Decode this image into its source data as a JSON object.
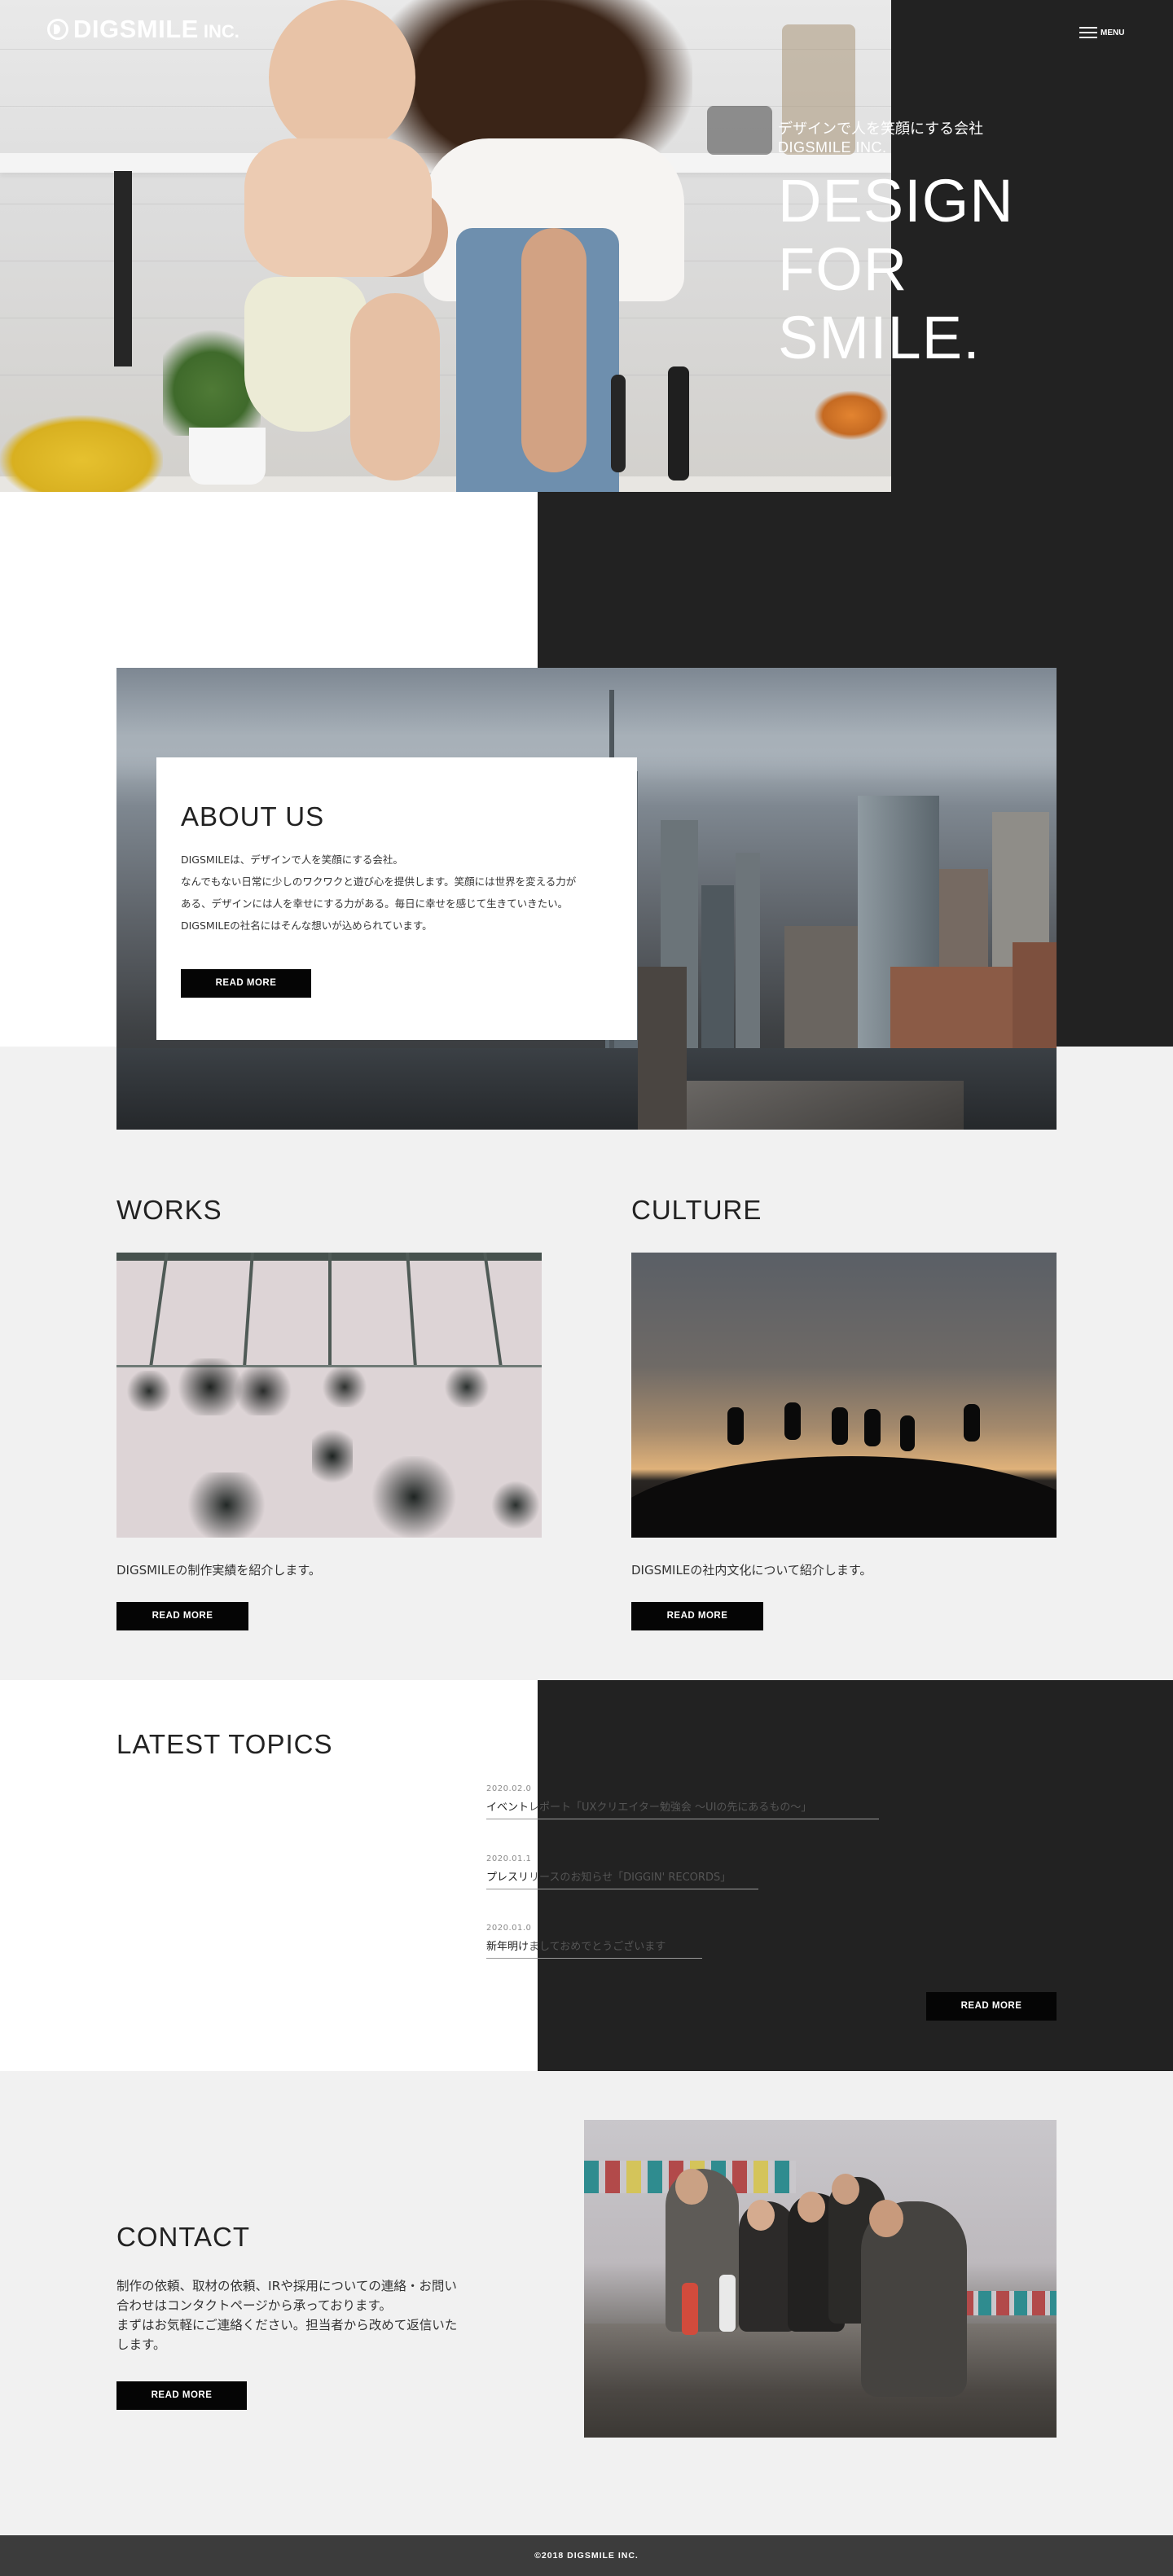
{
  "brand": {
    "name": "DIGSMILE",
    "suffix": "INC."
  },
  "nav": {
    "menu_label": "MENU"
  },
  "hero": {
    "tagline_jp": "デザインで人を笑顔にする会社",
    "company": "DIGSMILE INC.",
    "headline": [
      "DESIGN",
      "FOR",
      "SMILE."
    ]
  },
  "about": {
    "title": "ABOUT US",
    "lines": [
      "DIGSMILEは、デザインで人を笑顔にする会社。",
      "なんでもない日常に少しのワクワクと遊び心を提供します。笑顔には世界を変える力が",
      "ある、デザインには人を幸せにする力がある。毎日に幸せを感じて生きていきたい。",
      "DIGSMILEの社名にはそんな想いが込められています。"
    ],
    "button_label": "READ MORE"
  },
  "works": {
    "title": "WORKS",
    "description": "DIGSMILEの制作実績を紹介します。",
    "button_label": "READ MORE"
  },
  "culture": {
    "title": "CULTURE",
    "description": "DIGSMILEの社内文化について紹介します。",
    "button_label": "READ MORE"
  },
  "topics": {
    "title": "LATEST TOPICS",
    "items": [
      {
        "date": "2020.02.0",
        "title_dark": "イベント",
        "title_light": "レポート「UXクリエイター勉強会 ～UIの先にあるもの～」"
      },
      {
        "date": "2020.01.1",
        "title_dark": "プレスリ",
        "title_light": "リースのお知らせ「DIGGIN' RECORDS」"
      },
      {
        "date": "2020.01.0",
        "title_dark": "新年明け",
        "title_light": "ましておめでとうございます"
      }
    ],
    "button_label": "READ MORE"
  },
  "contact": {
    "title": "CONTACT",
    "lines": [
      "制作の依頼、取材の依頼、IRや採用についての連絡・お問い",
      "合わせはコンタクトページから承っております。",
      "まずはお気軽にご連絡ください。担当者から改めて返信いた",
      "します。"
    ],
    "button_label": "READ MORE"
  },
  "footer": {
    "copyright": "©2018 DIGSMILE INC."
  },
  "colors": {
    "dark_panel": "#222222",
    "button": "#050505",
    "page_bg": "#f1f1f1",
    "footer": "#3c3c3c"
  }
}
